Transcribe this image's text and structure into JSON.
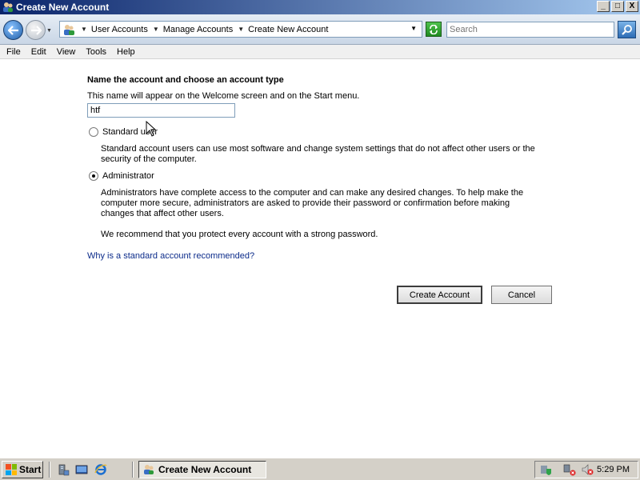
{
  "window": {
    "title": "Create New Account",
    "minimize": "_",
    "maximize": "□",
    "close": "X"
  },
  "address": {
    "breadcrumbs": [
      "User Accounts",
      "Manage Accounts",
      "Create New Account"
    ],
    "search_placeholder": "Search"
  },
  "menu": {
    "items": [
      "File",
      "Edit",
      "View",
      "Tools",
      "Help"
    ]
  },
  "form": {
    "heading": "Name the account and choose an account type",
    "subtext": "This name will appear on the Welcome screen and on the Start menu.",
    "name_value": "htf",
    "standard_label": "Standard user",
    "standard_desc": "Standard account users can use most software and change system settings that do not affect other users or the security of the computer.",
    "admin_label": "Administrator",
    "admin_desc": "Administrators have complete access to the computer and can make any desired changes. To help make the computer more secure, administrators are asked to provide their password or confirmation before making changes that affect other users.",
    "recommend": "We recommend that you protect every account with a strong password.",
    "link": "Why is a standard account recommended?",
    "selected": "Administrator",
    "create_label": "Create Account",
    "cancel_label": "Cancel"
  },
  "taskbar": {
    "start_label": "Start",
    "task_label": "Create New Account",
    "clock": "5:29 PM"
  }
}
